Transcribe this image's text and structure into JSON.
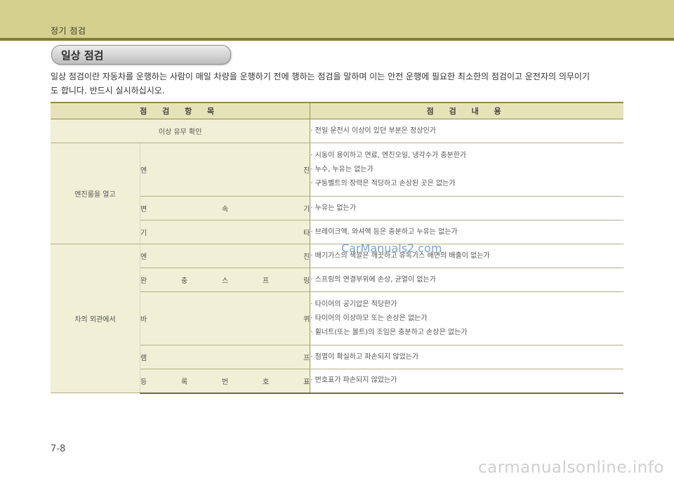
{
  "header": {
    "title": "정기 점검"
  },
  "section": {
    "title": "일상 점검"
  },
  "intro": {
    "line1": "일상 점검이란 자동차를 운행하는 사람이 매일 차량을 운행하기 전에 행하는 점검을 말하며 이는 안전 운행에 필요한 최소한의 점검이고 운전자의 의무이기",
    "line2": "도 합니다. 반드시 실시하십시오."
  },
  "table": {
    "headers": [
      "점 검 항 목",
      "점 검 내 용"
    ],
    "rows": [
      {
        "item": "이상 유무 확인",
        "content": [
          "· 전일 운전시 이상이 있던 부분은 정상인가"
        ]
      }
    ],
    "groups": [
      {
        "category": "엔진룸을 열고",
        "items": [
          {
            "sub": [
              "엔",
              "진"
            ],
            "content": [
              "· 시동이 용이하고 연료, 엔진오일, 냉각수가 충분한가",
              "· 누수, 누유는 없는가",
              "· 구동벨트의 장력은 적당하고 손상된 곳은 없는가"
            ]
          },
          {
            "sub": [
              "변",
              "속",
              "기"
            ],
            "content": [
              "· 누유는 없는가"
            ]
          },
          {
            "sub": [
              "기",
              "타"
            ],
            "content": [
              "· 브레이크액, 와셔액 등은 충분하고 누유는 없는가"
            ]
          }
        ]
      },
      {
        "category": "차의 외관에서",
        "items": [
          {
            "sub": [
              "엔",
              "진"
            ],
            "content": [
              "· 배기가스의 색깔은 깨끗하고 유독가스 배면의 배출이 없는가"
            ]
          },
          {
            "sub": [
              "완",
              "충",
              "스",
              "프",
              "링"
            ],
            "content": [
              "· 스프링의 연결부위에 손상, 균열이 없는가"
            ]
          },
          {
            "sub": [
              "바",
              "퀴"
            ],
            "content": [
              "· 타이어의 공기압은 적당한가",
              "· 타이어의 이상마모 또는 손상은 없는가",
              "· 휠너트(또는 볼트)의 조임은 충분하고 손상은 없는가"
            ]
          },
          {
            "sub": [
              "램",
              "프"
            ],
            "content": [
              "· 점멸이 확실하고 파손되지 않았는가"
            ]
          },
          {
            "sub": [
              "등",
              "록",
              "번",
              "호",
              "표"
            ],
            "content": [
              "· 번호표가 파손되지 않았는가"
            ]
          }
        ]
      }
    ]
  },
  "watermark": "CarManuals2.com",
  "page_number": "7-8",
  "site_mark": "carmanualsonline.info"
}
